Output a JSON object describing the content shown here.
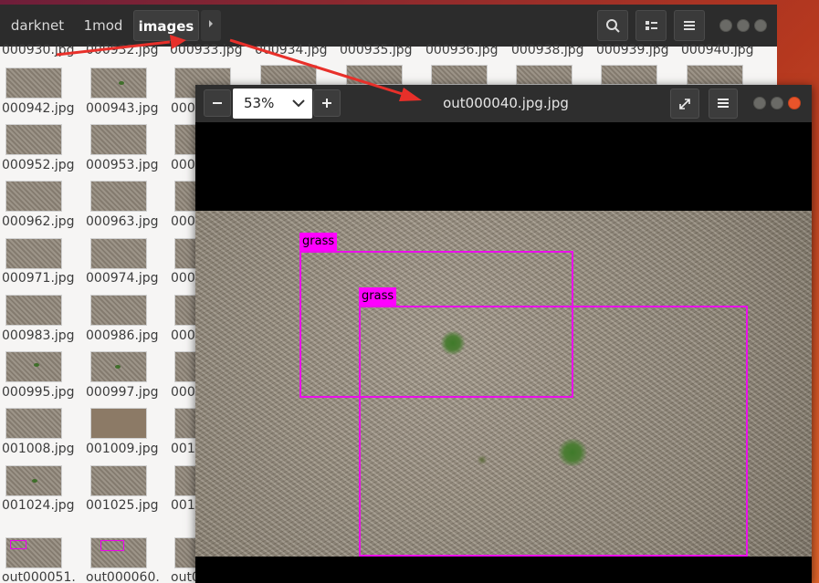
{
  "files_window": {
    "breadcrumbs": [
      "darknet",
      "1mod",
      "images"
    ],
    "top_cut_row": [
      "000930.jpg",
      "000932.jpg",
      "000933.jpg",
      "000934.jpg",
      "000935.jpg",
      "000936.jpg",
      "000938.jpg",
      "000939.jpg",
      "000940.jpg"
    ],
    "rows": [
      [
        "000942.jpg",
        "000943.jpg"
      ],
      [
        "000952.jpg",
        "000953.jpg"
      ],
      [
        "000962.jpg",
        "000963.jpg"
      ],
      [
        "000971.jpg",
        "000974.jpg"
      ],
      [
        "000983.jpg",
        "000986.jpg"
      ],
      [
        "000995.jpg",
        "000997.jpg"
      ],
      [
        "001008.jpg",
        "001009.jpg"
      ],
      [
        "001024.jpg",
        "001025.jpg"
      ],
      [
        "out000051.",
        "out000060."
      ]
    ],
    "partial_col": [
      "000",
      "000",
      "000",
      "000",
      "000",
      "000",
      "001",
      "001",
      "out0"
    ]
  },
  "viewer": {
    "zoom": "53%",
    "title": "out000040.jpg.jpg",
    "detections": [
      {
        "label": "grass"
      },
      {
        "label": "grass"
      }
    ]
  },
  "icons": {
    "zoom_out": "minus-icon",
    "zoom_in": "plus-icon",
    "fullscreen": "expand-icon",
    "menu": "hamburger-icon",
    "search": "search-icon",
    "view": "list-view-icon"
  }
}
